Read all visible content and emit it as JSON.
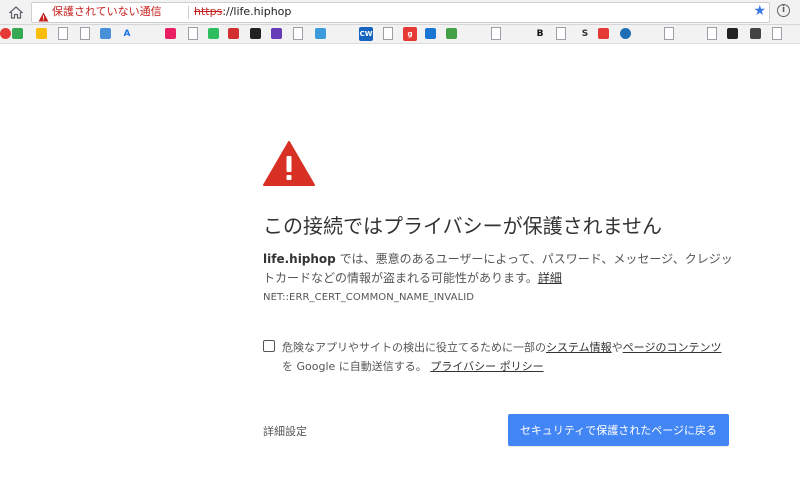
{
  "omnibox": {
    "security_label": "保護されていない通信",
    "url_scheme": "https",
    "url_rest": "://life.hiphop"
  },
  "bookmarks": [
    {
      "icon": "red-circle-icon",
      "text": "",
      "color": "#e53935"
    },
    {
      "icon": "google-drive-icon",
      "text": "",
      "color": "#34a853"
    },
    {
      "icon": "pinwheel-icon",
      "text": "",
      "color": "#fbbc05"
    },
    {
      "icon": "page-icon",
      "text": ""
    },
    {
      "icon": "page-icon",
      "text": ""
    },
    {
      "icon": "globe-icon",
      "text": "",
      "color": "#4a90d9"
    },
    {
      "icon": "adwords-icon",
      "text": "A",
      "color": "#1a73e8"
    },
    {
      "icon": "link-icon",
      "text": "",
      "color": "#e91e63"
    },
    {
      "icon": "page-icon",
      "text": ""
    },
    {
      "icon": "evernote-icon",
      "text": "",
      "color": "#2dbe60"
    },
    {
      "icon": "red-square-icon",
      "text": "",
      "color": "#d32f2f"
    },
    {
      "icon": "dark-square-icon",
      "text": "",
      "color": "#222222"
    },
    {
      "icon": "feather-icon",
      "text": "",
      "color": "#673ab7"
    },
    {
      "icon": "page-icon",
      "text": ""
    },
    {
      "icon": "checklist-icon",
      "text": "",
      "color": "#3b9bdb"
    },
    {
      "icon": "cw-icon",
      "text": "CW",
      "color": "#1565c0"
    },
    {
      "icon": "page-icon",
      "text": ""
    },
    {
      "icon": "g-icon",
      "text": "g",
      "color": "#e53935"
    },
    {
      "icon": "arrow-icon",
      "text": "",
      "color": "#1976d2"
    },
    {
      "icon": "plus-icon",
      "text": "",
      "color": "#43a047"
    },
    {
      "icon": "page-icon",
      "text": ""
    },
    {
      "icon": "b-icon",
      "text": "B",
      "color": "#111111"
    },
    {
      "icon": "page-icon",
      "text": ""
    },
    {
      "icon": "s-icon",
      "text": "S",
      "color": "#333333"
    },
    {
      "icon": "red-badge-icon",
      "text": "",
      "color": "#e53935"
    },
    {
      "icon": "blue-circle-icon",
      "text": "",
      "color": "#1e6fb5"
    },
    {
      "icon": "page-icon",
      "text": ""
    },
    {
      "icon": "page-icon",
      "text": ""
    },
    {
      "icon": "dark-logo-icon",
      "text": "",
      "color": "#222222"
    },
    {
      "icon": "cross-icon",
      "text": "",
      "color": "#444444"
    },
    {
      "icon": "page-icon",
      "text": ""
    }
  ],
  "interstitial": {
    "heading": "この接続ではプライバシーが保護されません",
    "host": "life.hiphop",
    "body": " では、悪意のあるユーザーによって、パスワード、メッセージ、クレジットカードなどの情報が盗まれる可能性があります。",
    "details_link": "詳細",
    "error_code": "NET::ERR_CERT_COMMON_NAME_INVALID",
    "report_prefix": "危険なアプリやサイトの検出に役立てるために一部の",
    "report_link1": "システム情報",
    "report_mid": "や",
    "report_link2": "ページのコンテンツ",
    "report_suffix": "を Google に自動送信する。",
    "privacy_link": "プライバシー ポリシー",
    "advanced_button": "詳細設定",
    "back_button": "セキュリティで保護されたページに戻る"
  },
  "colors": {
    "warning_red": "#d93025",
    "primary_blue": "#4285f4"
  }
}
